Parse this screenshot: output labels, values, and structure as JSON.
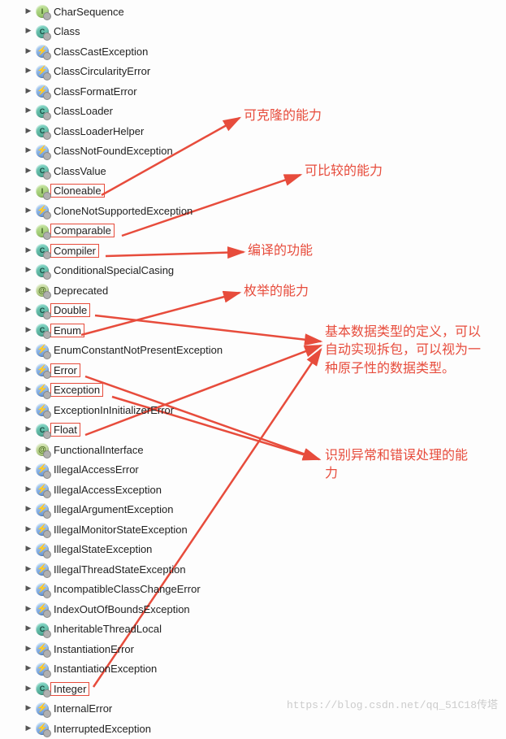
{
  "items": [
    {
      "icon": "I",
      "label": "CharSequence"
    },
    {
      "icon": "C",
      "label": "Class"
    },
    {
      "icon": "bolt",
      "label": "ClassCastException"
    },
    {
      "icon": "bolt",
      "label": "ClassCircularityError"
    },
    {
      "icon": "bolt",
      "label": "ClassFormatError"
    },
    {
      "icon": "C",
      "label": "ClassLoader"
    },
    {
      "icon": "C",
      "label": "ClassLoaderHelper"
    },
    {
      "icon": "bolt",
      "label": "ClassNotFoundException"
    },
    {
      "icon": "C",
      "label": "ClassValue"
    },
    {
      "icon": "I",
      "label": "Cloneable",
      "boxed": true
    },
    {
      "icon": "bolt",
      "label": "CloneNotSupportedException"
    },
    {
      "icon": "I",
      "label": "Comparable",
      "boxed": true
    },
    {
      "icon": "C",
      "label": "Compiler",
      "boxed": true
    },
    {
      "icon": "C",
      "label": "ConditionalSpecialCasing"
    },
    {
      "icon": "anno",
      "label": "Deprecated"
    },
    {
      "icon": "C",
      "label": "Double",
      "boxed": true
    },
    {
      "icon": "C",
      "label": "Enum",
      "boxed": true
    },
    {
      "icon": "bolt",
      "label": "EnumConstantNotPresentException"
    },
    {
      "icon": "bolt",
      "label": "Error",
      "boxed": true
    },
    {
      "icon": "bolt",
      "label": "Exception",
      "boxed": true
    },
    {
      "icon": "bolt",
      "label": "ExceptionInInitializerError"
    },
    {
      "icon": "C",
      "label": "Float",
      "boxed": true
    },
    {
      "icon": "anno",
      "label": "FunctionalInterface"
    },
    {
      "icon": "bolt",
      "label": "IllegalAccessError"
    },
    {
      "icon": "bolt",
      "label": "IllegalAccessException"
    },
    {
      "icon": "bolt",
      "label": "IllegalArgumentException"
    },
    {
      "icon": "bolt",
      "label": "IllegalMonitorStateException"
    },
    {
      "icon": "bolt",
      "label": "IllegalStateException"
    },
    {
      "icon": "bolt",
      "label": "IllegalThreadStateException"
    },
    {
      "icon": "bolt",
      "label": "IncompatibleClassChangeError"
    },
    {
      "icon": "bolt",
      "label": "IndexOutOfBoundsException"
    },
    {
      "icon": "C",
      "label": "InheritableThreadLocal"
    },
    {
      "icon": "bolt",
      "label": "InstantiationError"
    },
    {
      "icon": "bolt",
      "label": "InstantiationException"
    },
    {
      "icon": "C",
      "label": "Integer",
      "boxed": true
    },
    {
      "icon": "bolt",
      "label": "InternalError"
    },
    {
      "icon": "bolt",
      "label": "InterruptedException"
    }
  ],
  "callouts": {
    "c1": "可克隆的能力",
    "c2": "可比较的能力",
    "c3": "编译的功能",
    "c4": "枚举的能力",
    "c5": "基本数据类型的定义，可以自动实现拆包，可以视为一种原子性的数据类型。",
    "c6": "识别异常和错误处理的能力"
  },
  "watermark": "https://blog.csdn.net/qq_51C18传塔"
}
